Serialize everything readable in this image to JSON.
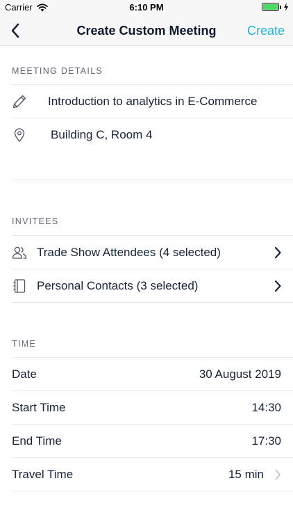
{
  "status_bar": {
    "carrier": "Carrier",
    "time": "6:10 PM",
    "battery_color": "#4cd964"
  },
  "nav": {
    "back_icon": "chevron-left-icon",
    "title": "Create Custom Meeting",
    "action_label": "Create",
    "action_color": "#1fb3e0"
  },
  "meeting_details": {
    "header": "MEETING DETAILS",
    "title_value": "Introduction to analytics in E-Commerce",
    "title_icon": "pencil-icon",
    "location_value": "Building C, Room 4",
    "location_icon": "location-pin-icon"
  },
  "invitees": {
    "header": "INVITEES",
    "items": [
      {
        "label": "Trade Show Attendees (4 selected)",
        "icon": "people-icon"
      },
      {
        "label": "Personal Contacts (3 selected)",
        "icon": "address-book-icon"
      }
    ]
  },
  "time": {
    "header": "TIME",
    "rows": [
      {
        "label": "Date",
        "value": "30 August 2019"
      },
      {
        "label": "Start Time",
        "value": "14:30"
      },
      {
        "label": "End Time",
        "value": "17:30"
      },
      {
        "label": "Travel Time",
        "value": "15 min"
      }
    ]
  }
}
